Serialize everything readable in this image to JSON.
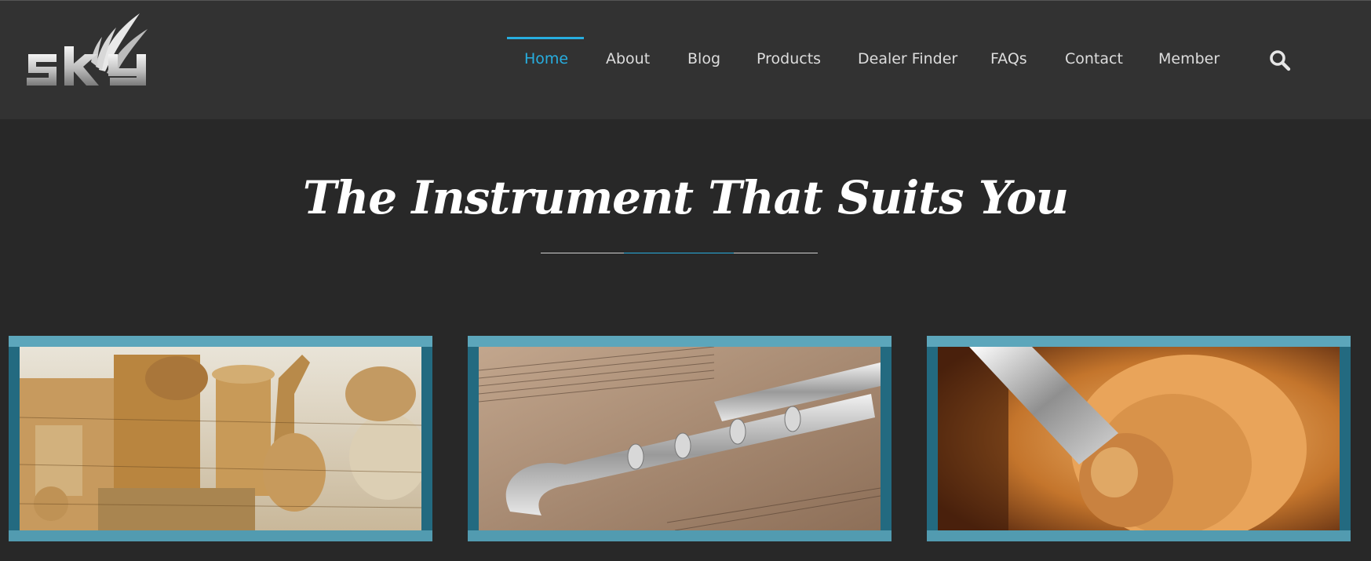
{
  "brand": {
    "logo_text": "sky"
  },
  "nav": {
    "items": [
      {
        "label": "Home",
        "active": true
      },
      {
        "label": "About"
      },
      {
        "label": "Blog"
      },
      {
        "label": "Products"
      },
      {
        "label": "Dealer Finder"
      },
      {
        "label": "FAQs"
      },
      {
        "label": "Contact"
      },
      {
        "label": "Member"
      }
    ],
    "search_icon": "search-icon",
    "accent_color": "#27aee0"
  },
  "hero": {
    "title": "The Instrument That Suits You"
  },
  "cards": [
    {
      "image": "paper-instruments-photo"
    },
    {
      "image": "flute-sheet-music-photo"
    },
    {
      "image": "violin-scroll-carving-photo"
    }
  ]
}
